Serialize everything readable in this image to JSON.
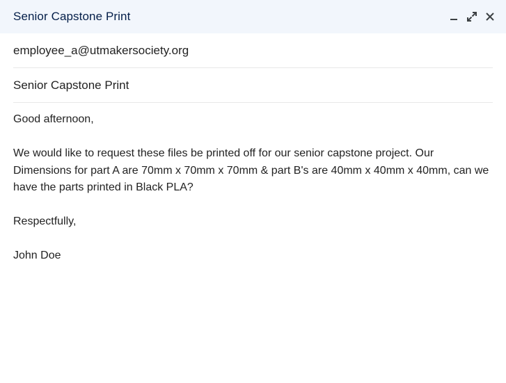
{
  "compose": {
    "title": "Senior Capstone Print",
    "icons": {
      "minimize": "minimize-icon",
      "expand": "expand-icon",
      "close": "close-icon"
    },
    "to": "employee_a@utmakersociety.org",
    "subject": "Senior Capstone Print",
    "body": {
      "greeting": "Good afternoon,",
      "paragraph": "We would like to request these files be printed off for our senior capstone project. Our Dimensions for part A are 70mm x 70mm x 70mm & part B's are 40mm x 40mm x 40mm, can we have the parts printed in Black PLA?",
      "closing": "Respectfully,",
      "signature": "John Doe"
    }
  },
  "colors": {
    "header_bg": "#f2f6fc",
    "title_text": "#041e49",
    "body_text": "#222222",
    "divider": "#e8e8e8"
  }
}
